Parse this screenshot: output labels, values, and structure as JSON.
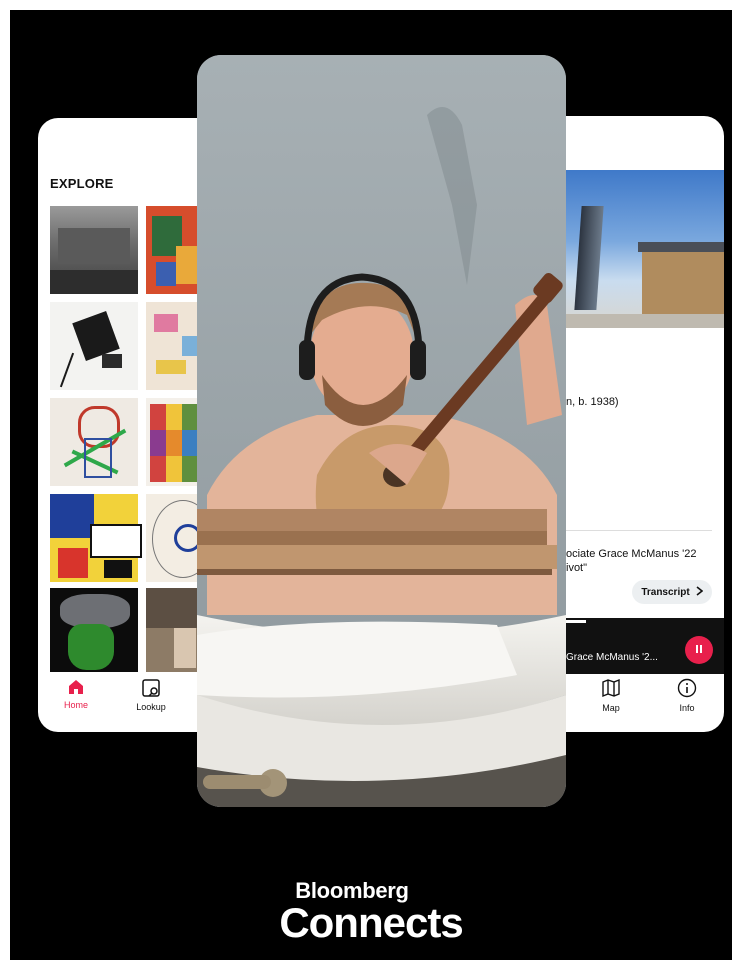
{
  "colors": {
    "accent": "#e8204c",
    "background": "#000000"
  },
  "left_phone": {
    "section_title": "EXPLORE",
    "tabs": [
      {
        "label": "Home",
        "icon": "home-icon",
        "active": true
      },
      {
        "label": "Lookup",
        "icon": "lookup-icon",
        "active": false
      }
    ]
  },
  "right_phone": {
    "artist_fragment": "n, b. 1938)",
    "audio_line1": "ociate Grace McManus '22",
    "audio_line2": "ivot\"",
    "transcript_label": "Transcript",
    "player_title": "Grace McManus '2...",
    "tabs": [
      {
        "label": "Map",
        "icon": "map-icon"
      },
      {
        "label": "Info",
        "icon": "info-icon"
      }
    ]
  },
  "brand": {
    "line1": "Bloomberg",
    "line2": "Connects"
  }
}
